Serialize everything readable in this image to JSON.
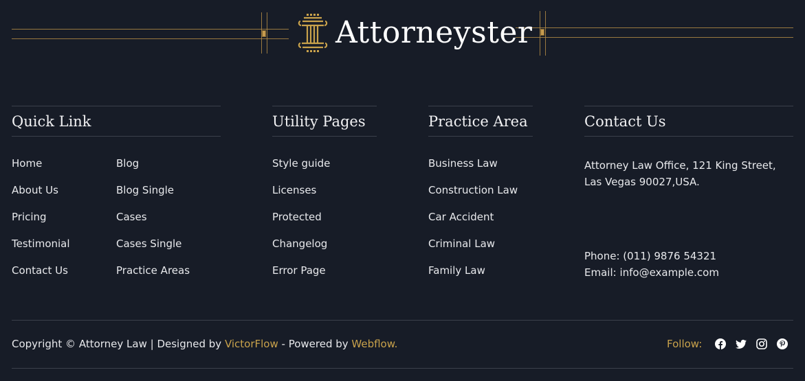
{
  "brand": {
    "name": "Attorneyster"
  },
  "columns": {
    "quick_link": {
      "title": "Quick Link",
      "left": [
        "Home",
        "About Us",
        "Pricing",
        "Testimonial",
        "Contact Us"
      ],
      "right": [
        "Blog",
        "Blog Single",
        "Cases",
        "Cases Single",
        "Practice Areas"
      ]
    },
    "utility": {
      "title": "Utility Pages",
      "items": [
        "Style guide",
        "Licenses",
        "Protected",
        "Changelog",
        "Error Page"
      ]
    },
    "practice": {
      "title": "Practice Area",
      "items": [
        "Business Law",
        "Construction Law",
        "Car Accident",
        "Criminal Law",
        "Family Law"
      ]
    },
    "contact": {
      "title": "Contact Us",
      "address": "Attorney Law Office, 121 King Street, Las Vegas 90027,USA.",
      "phone": "Phone: (011) 9876 54321",
      "email": "Email: info@example.com"
    }
  },
  "footer": {
    "copyright_prefix": "Copyright © Attorney Law | Designed by ",
    "designer": "VictorFlow",
    "powered_prefix": " - Powered by ",
    "platform": "Webflow.",
    "follow_label": "Follow:"
  },
  "colors": {
    "background": "#171c27",
    "accent": "#c9a24b",
    "divider": "#3b404b"
  },
  "icons": [
    "pillar-logo-icon",
    "facebook-icon",
    "twitter-icon",
    "instagram-icon",
    "pinterest-icon"
  ]
}
